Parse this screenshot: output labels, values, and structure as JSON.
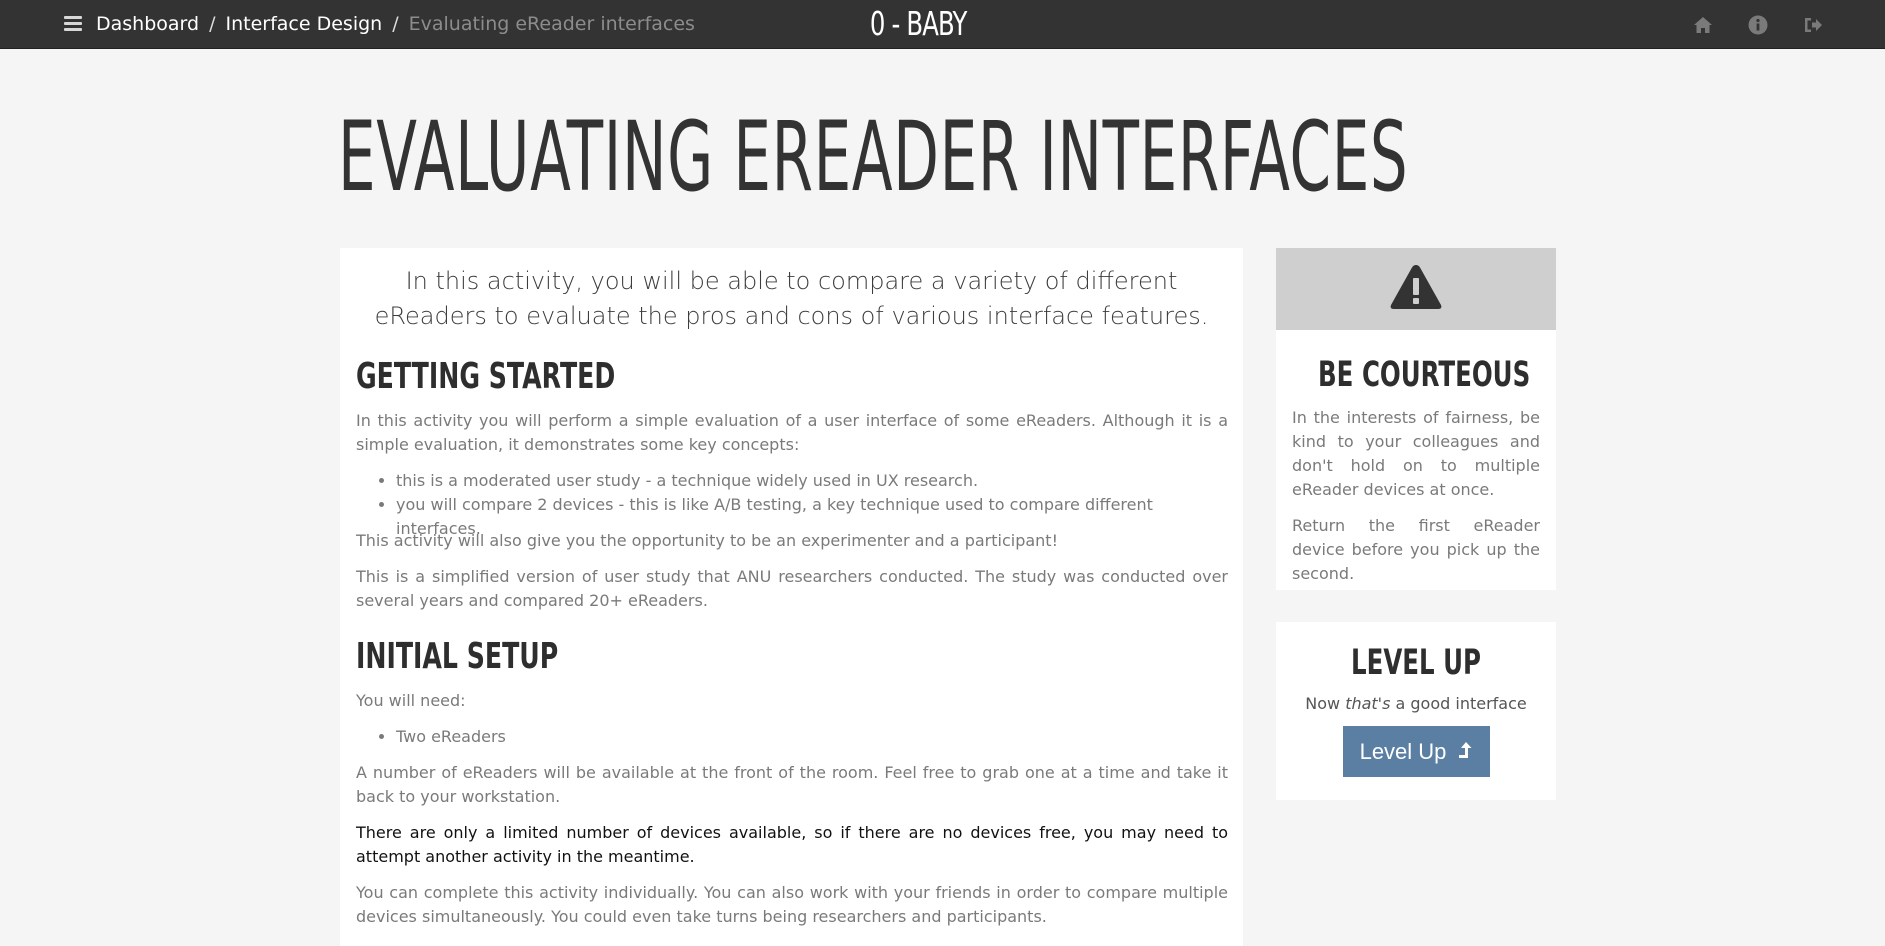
{
  "navbar": {
    "breadcrumb": {
      "dashboard": "Dashboard",
      "separator": "/",
      "category": "Interface Design",
      "current": "Evaluating eReader interfaces"
    },
    "brand": "0 - BABY",
    "icons": [
      "menu-icon",
      "home-icon",
      "info-icon",
      "sign-out-icon"
    ]
  },
  "page": {
    "title": "EVALUATING EREADER INTERFACES"
  },
  "main": {
    "lead": "In this activity, you will be able to compare a variety of different eReaders to evaluate the pros and cons of various interface features.",
    "getting_started": {
      "heading": "GETTING STARTED",
      "intro": "In this activity you will perform a simple evaluation of a user interface of some eReaders. Although it is a simple evaluation, it demonstrates some key concepts:",
      "bullets": [
        "this is a moderated user study - a technique widely used in UX research.",
        "you will compare 2 devices - this is like A/B testing, a key technique used to compare different interfaces."
      ],
      "para2": "This activity will also give you the opportunity to be an experimenter and a participant!",
      "para3": "This is a simplified version of user study that ANU researchers conducted. The study was conducted over several years and compared 20+ eReaders."
    },
    "initial_setup": {
      "heading": "INITIAL SETUP",
      "need": "You will need:",
      "bullets": [
        "Two eReaders"
      ],
      "para1": "A number of eReaders will be available at the front of the room. Feel free to grab one at a time and take it back to your workstation.",
      "para2": "There are only a limited number of devices available, so if there are no devices free, you may need to attempt another activity in the meantime.",
      "para3": "You can complete this activity individually. You can also work with your friends in order to compare multiple devices simultaneously. You could even take turns being researchers and participants."
    }
  },
  "sidebar": {
    "courteous": {
      "icon": "warning-icon",
      "heading": "BE COURTEOUS",
      "para1": "In the interests of fairness, be kind to your colleagues and don't hold on to multiple eReader devices at once.",
      "para2": "Return the first eReader device before you pick up the second."
    },
    "levelup": {
      "heading": "LEVEL UP",
      "text_prefix": "Now ",
      "text_em": "that's",
      "text_suffix": " a good interface",
      "button_label": "Level Up",
      "button_icon": "level-up-icon"
    }
  },
  "colors": {
    "navbar_bg": "#333333",
    "page_bg": "#f5f5f5",
    "card_bg": "#ffffff",
    "warning_header_bg": "#cfcfcf",
    "button_bg": "#5b7fa3",
    "muted_text": "#7a7a7a",
    "breadcrumb_current": "#8c8c8c"
  }
}
